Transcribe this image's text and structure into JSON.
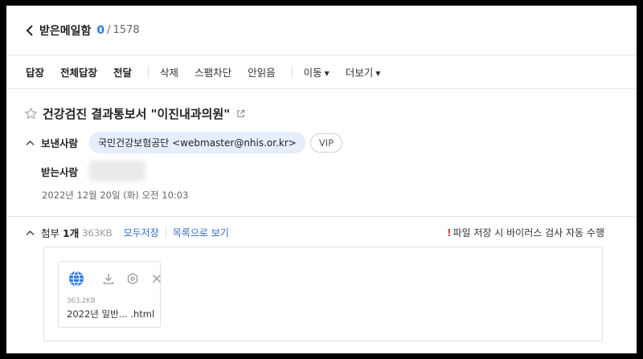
{
  "mailbox": {
    "name": "받은메일함",
    "unread": "0",
    "separator": "/",
    "total": "1578"
  },
  "toolbar": {
    "reply": "답장",
    "reply_all": "전체답장",
    "forward": "전달",
    "delete": "삭제",
    "spam": "스팸차단",
    "mark_unread": "안읽음",
    "move": "이동",
    "more": "더보기"
  },
  "message": {
    "subject": "건강검진 결과통보서 \"이진내과의원\"",
    "sender_label": "보낸사람",
    "sender": "국민건강보험공단 <webmaster@nhis.or.kr>",
    "vip_label": "VIP",
    "recipient_label": "받는사람",
    "date": "2022년 12월 20일 (화) 오전 10:03"
  },
  "attachments": {
    "label": "첨부",
    "count": "1개",
    "total_size": "363KB",
    "save_all": "모두저장",
    "view_list": "목록으로 보기",
    "warning_mark": "!",
    "warning": "파일 저장 시 바이러스 검사 자동 수행",
    "files": [
      {
        "size": "363.2KB",
        "name": "2022년 일반... .html"
      }
    ]
  },
  "colors": {
    "accent": "#2c7be5",
    "link": "#2c6bc9",
    "chip_bg": "#e4eefc",
    "warning": "#e03131"
  }
}
